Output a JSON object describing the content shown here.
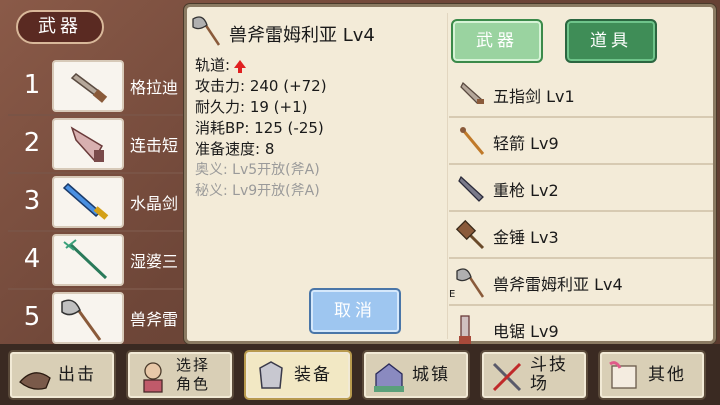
{
  "left_panel": {
    "tab_label": "武器",
    "rows": [
      {
        "num": "1",
        "name": "格拉迪"
      },
      {
        "num": "2",
        "name": "连击短"
      },
      {
        "num": "3",
        "name": "水晶剑"
      },
      {
        "num": "4",
        "name": "湿婆三"
      },
      {
        "num": "5",
        "name": "兽斧雷"
      }
    ]
  },
  "detail": {
    "title": "兽斧雷姆利亚 Lv4",
    "track_label": "轨道:",
    "stats": [
      "攻击力: 240 (+72)",
      "耐久力: 19 (+1)",
      "消耗BP: 125 (-25)",
      "准备速度: 8"
    ],
    "locked": [
      "奥义:  Lv5开放(斧A)",
      "秘义:  Lv9开放(斧A)"
    ],
    "cancel_label": "取消"
  },
  "tabs": {
    "weapon": "武器",
    "item": "道具"
  },
  "items": [
    {
      "name": "五指剑 Lv1",
      "icon": "dagger-icon"
    },
    {
      "name": "轻箭 Lv9",
      "icon": "arrow-icon"
    },
    {
      "name": "重枪 Lv2",
      "icon": "lance-icon"
    },
    {
      "name": "金锤 Lv3",
      "icon": "hammer-icon"
    },
    {
      "name": "兽斧雷姆利亚 Lv4",
      "icon": "axe-icon",
      "marker": "E"
    },
    {
      "name": "电锯 Lv9",
      "icon": "chainsaw-icon"
    }
  ],
  "bottom_nav": [
    {
      "label": "出击"
    },
    {
      "label": "选择\n角色"
    },
    {
      "label": "装备"
    },
    {
      "label": "城镇"
    },
    {
      "label": "斗技场"
    },
    {
      "label": "其他"
    }
  ],
  "colors": {
    "accent_green": "#3f8d57",
    "cancel_blue": "#9ec6f0",
    "panel": "#f3ebd8",
    "track_arrow": "#e02020"
  }
}
